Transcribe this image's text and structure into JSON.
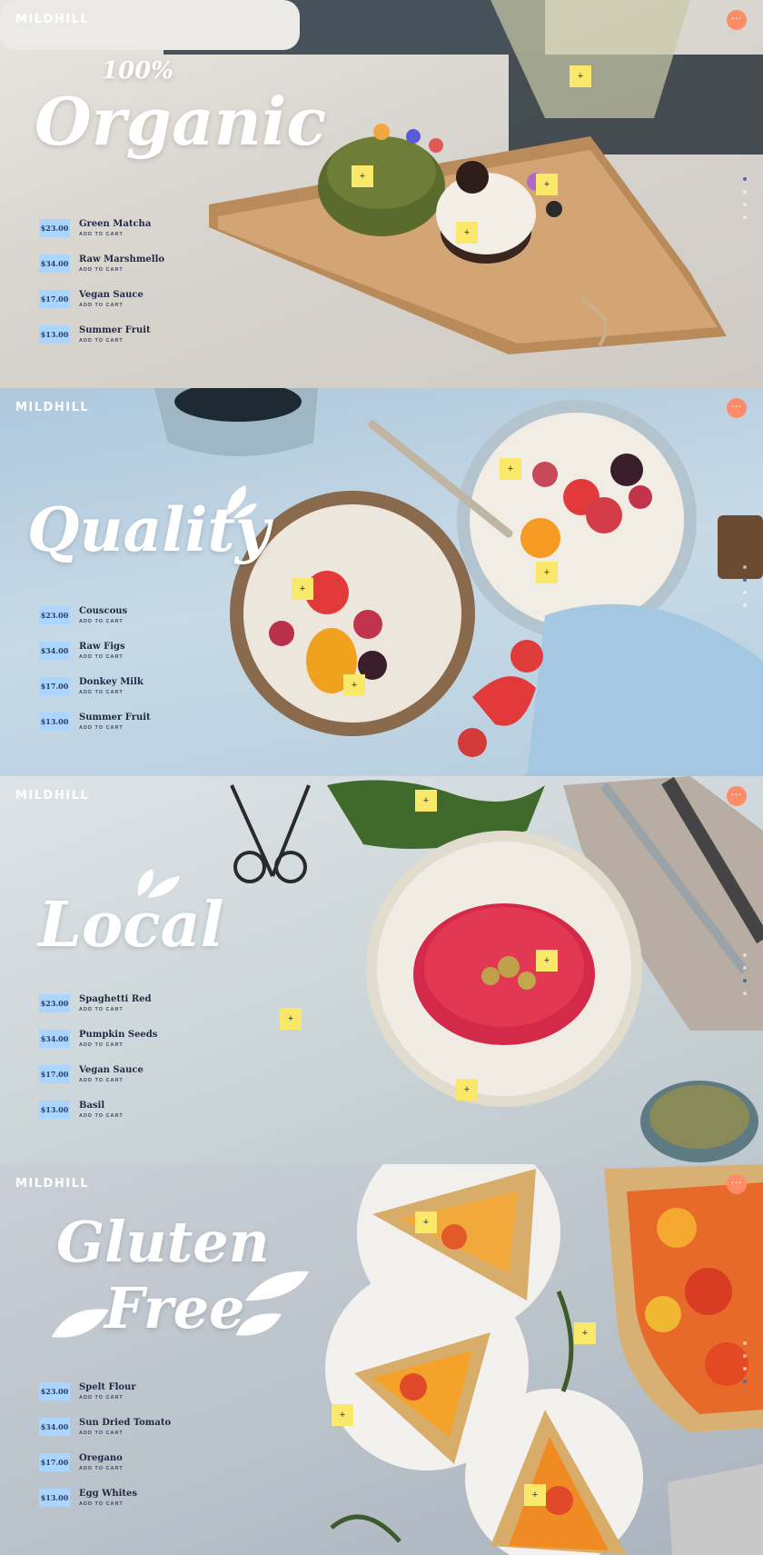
{
  "brand": "MILDHILL",
  "add_to_cart": "ADD TO CART",
  "hotspot_symbol": "+",
  "menu_symbol": "⋯",
  "colors": {
    "menu_button": "#ff8c69",
    "price_tag": "#a9d5ff",
    "hotspot": "#f9e86a",
    "item_text": "#1e2a44"
  },
  "panels": [
    {
      "headline_top": "100%",
      "headline": "Organic",
      "items": [
        {
          "price": "$23.00",
          "name": "Green Matcha"
        },
        {
          "price": "$34.00",
          "name": "Raw Marshmello"
        },
        {
          "price": "$17.00",
          "name": "Vegan Sauce"
        },
        {
          "price": "$13.00",
          "name": "Summer Fruit"
        }
      ]
    },
    {
      "headline": "Quality",
      "items": [
        {
          "price": "$23.00",
          "name": "Couscous"
        },
        {
          "price": "$34.00",
          "name": "Raw Figs"
        },
        {
          "price": "$17.00",
          "name": "Donkey Milk"
        },
        {
          "price": "$13.00",
          "name": "Summer Fruit"
        }
      ]
    },
    {
      "headline": "Local",
      "items": [
        {
          "price": "$23.00",
          "name": "Spaghetti Red"
        },
        {
          "price": "$34.00",
          "name": "Pumpkin Seeds"
        },
        {
          "price": "$17.00",
          "name": "Vegan Sauce"
        },
        {
          "price": "$13.00",
          "name": "Basil"
        }
      ]
    },
    {
      "headline": "Gluten",
      "headline_bottom": "Free",
      "items": [
        {
          "price": "$23.00",
          "name": "Spelt Flour"
        },
        {
          "price": "$34.00",
          "name": "Sun Dried Tomato"
        },
        {
          "price": "$17.00",
          "name": "Oregano"
        },
        {
          "price": "$13.00",
          "name": "Egg Whites"
        }
      ]
    }
  ]
}
